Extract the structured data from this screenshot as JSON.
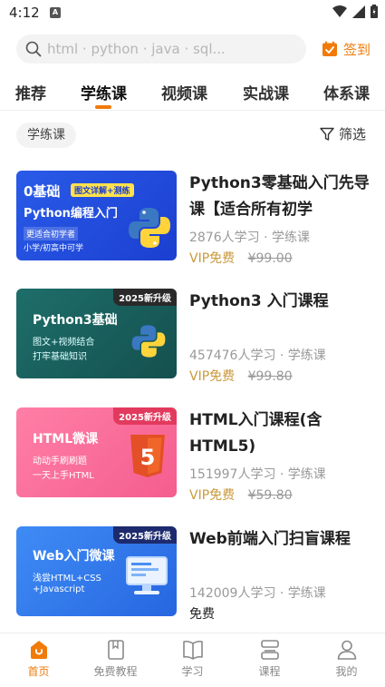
{
  "status_bar": {
    "time": "4:12",
    "notification_badge": "A"
  },
  "search": {
    "placeholder": "html · python · java · sql..."
  },
  "checkin": {
    "label": "签到"
  },
  "tabs": [
    {
      "label": "推荐"
    },
    {
      "label": "学练课",
      "active": true
    },
    {
      "label": "视频课"
    },
    {
      "label": "实战课"
    },
    {
      "label": "体系课"
    }
  ],
  "filter_bar": {
    "chip_label": "学练课",
    "filter_label": "筛选"
  },
  "courses": [
    {
      "title": "Python3零基础入门先导课【适合所有初学",
      "meta": "2876人学习 · 学练课",
      "price_label": "VIP免费",
      "original_price": "¥99.00",
      "thumb": {
        "line1": "0基础",
        "line2": "Python编程入门",
        "tag": "图文详解+测练",
        "sub1": "更适合初学者",
        "sub2": "小学/初高中可学"
      }
    },
    {
      "title": "Python3 入门课程",
      "meta": "457476人学习 · 学练课",
      "price_label": "VIP免费",
      "original_price": "¥99.80",
      "thumb": {
        "badge": "2025新升级",
        "line1": "Python3基础",
        "sub1": "图文+视频结合",
        "sub2": "打牢基础知识"
      }
    },
    {
      "title": "HTML入门课程(含HTML5)",
      "meta": "151997人学习 · 学练课",
      "price_label": "VIP免费",
      "original_price": "¥59.80",
      "thumb": {
        "badge": "2025新升级",
        "line1": "HTML微课",
        "sub1": "动动手刷刷题",
        "sub2": "一天上手HTML",
        "logo_num": "5"
      }
    },
    {
      "title": "Web前端入门扫盲课程",
      "meta": "142009人学习 · 学练课",
      "price_label": "免费",
      "thumb": {
        "badge": "2025新升级",
        "line1": "Web入门微课",
        "sub1": "浅尝HTML+CSS",
        "sub2": "+Javascript"
      }
    }
  ],
  "bottom_nav": [
    {
      "label": "首页",
      "icon": "home-icon",
      "active": true
    },
    {
      "label": "免费教程",
      "icon": "book-icon"
    },
    {
      "label": "学习",
      "icon": "open-book-icon"
    },
    {
      "label": "课程",
      "icon": "stack-icon"
    },
    {
      "label": "我的",
      "icon": "profile-icon"
    }
  ],
  "colors": {
    "accent": "#f07b0a",
    "vip": "#c99a3c"
  }
}
